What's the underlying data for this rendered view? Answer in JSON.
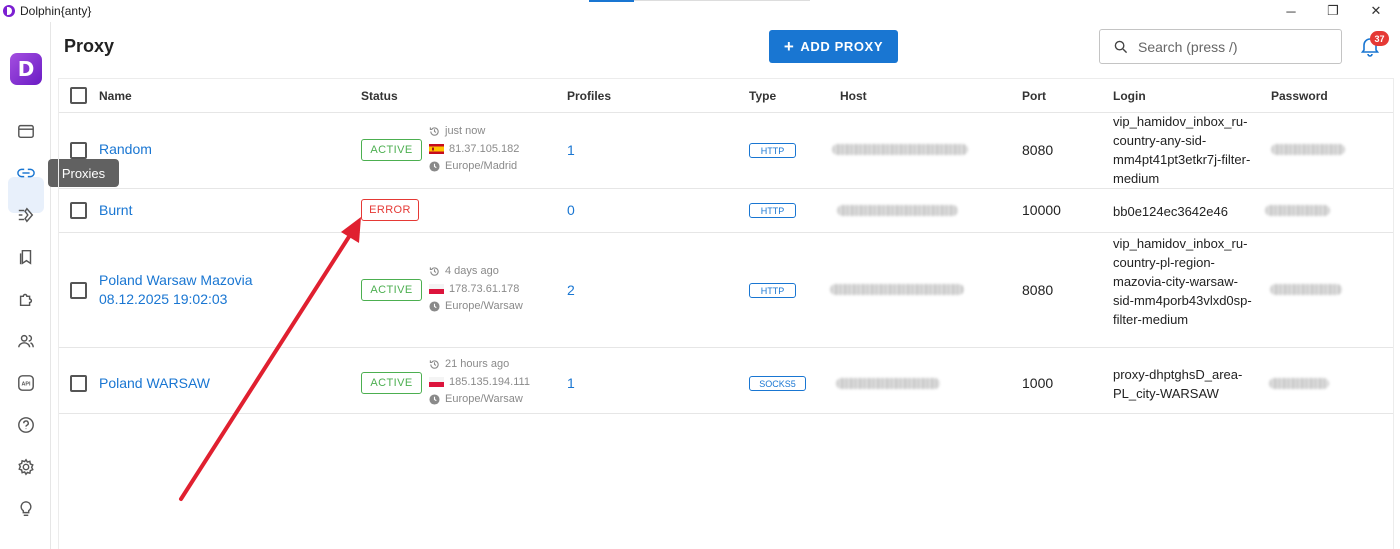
{
  "window": {
    "title": "Dolphin{anty}",
    "minimize": "─",
    "restore": "❐",
    "close": "✕"
  },
  "sidebar": {
    "logo_letter": "D",
    "tooltip": "Proxies",
    "items": [
      "browser-window-icon",
      "link-icon",
      "automation-icon",
      "bookmarks-icon",
      "extensions-icon",
      "users-icon",
      "api-icon",
      "help-icon",
      "settings-icon",
      "lightbulb-icon"
    ]
  },
  "header": {
    "title": "Proxy",
    "add_button": "ADD PROXY",
    "search_placeholder": "Search (press /)",
    "notification_count": "37"
  },
  "table": {
    "columns": [
      "Name",
      "Status",
      "Profiles",
      "Type",
      "Host",
      "Port",
      "Login",
      "Password"
    ],
    "rows": [
      {
        "name": "Random",
        "status": "ACTIVE",
        "last_check": "just now",
        "ip": "81.37.105.182",
        "timezone": "Europe/Madrid",
        "country_flag": "es",
        "profiles": "1",
        "type": "HTTP",
        "port": "8080",
        "login": "vip_hamidov_inbox_ru-country-any-sid-mm4pt41pt3etkr7j-filter-medium"
      },
      {
        "name": "Burnt",
        "status": "ERROR",
        "last_check": "",
        "ip": "",
        "timezone": "",
        "country_flag": "",
        "profiles": "0",
        "type": "HTTP",
        "port": "10000",
        "login": "bb0e124ec3642e46"
      },
      {
        "name": "Poland Warsaw Mazovia 08.12.2025 19:02:03",
        "status": "ACTIVE",
        "last_check": "4 days ago",
        "ip": "178.73.61.178",
        "timezone": "Europe/Warsaw",
        "country_flag": "pl",
        "profiles": "2",
        "type": "HTTP",
        "port": "8080",
        "login": "vip_hamidov_inbox_ru-country-pl-region-mazovia-city-warsaw-sid-mm4porb43vlxd0sp-filter-medium"
      },
      {
        "name": "Poland WARSAW",
        "status": "ACTIVE",
        "last_check": "21 hours ago",
        "ip": "185.135.194.111",
        "timezone": "Europe/Warsaw",
        "country_flag": "pl",
        "profiles": "1",
        "type": "SOCKS5",
        "port": "1000",
        "login": "proxy-dhptghsD_area-PL_city-WARSAW"
      }
    ]
  },
  "colors": {
    "accent": "#1976d2",
    "active": "#4caf50",
    "error": "#e53935",
    "annotation_arrow": "#e02030"
  }
}
